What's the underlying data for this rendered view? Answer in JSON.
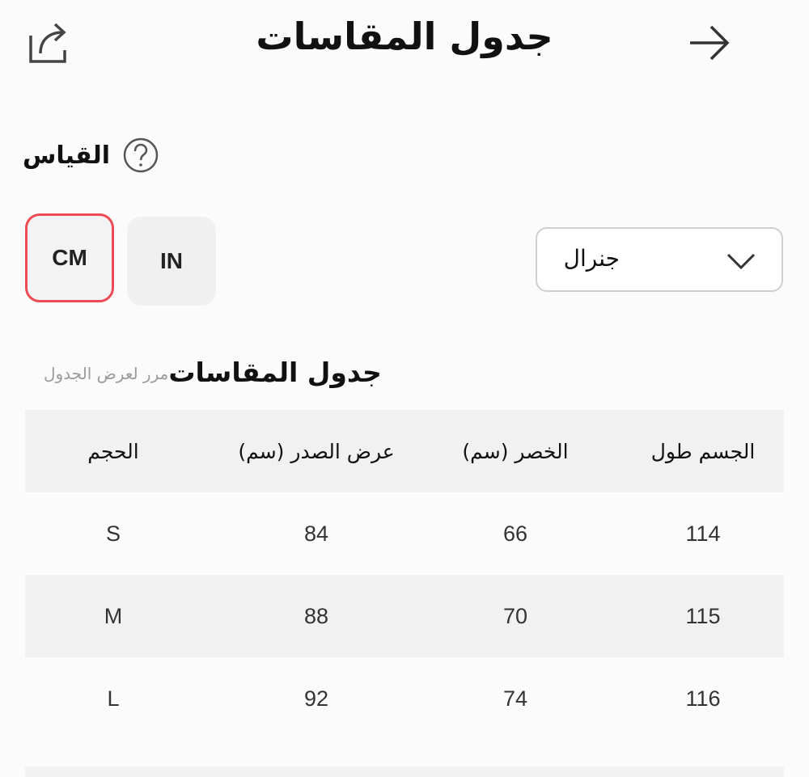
{
  "header": {
    "title": "جدول المقاسات"
  },
  "size_section": {
    "label": "القياس",
    "units": [
      {
        "label": "CM",
        "selected": true
      },
      {
        "label": "IN",
        "selected": false
      }
    ],
    "dropdown": {
      "value": "جنرال"
    }
  },
  "chart_section": {
    "title": "جدول المقاسات",
    "hint": "مرر لعرض الجدول"
  },
  "table": {
    "headers": [
      "الجسم طول",
      "الخصر (سم)",
      "عرض الصدر (سم)",
      "الحجم"
    ],
    "rows": [
      [
        "114",
        "66",
        "84",
        "S"
      ],
      [
        "115",
        "70",
        "88",
        "M"
      ],
      [
        "116",
        "74",
        "92",
        "L"
      ]
    ]
  },
  "colors": {
    "accent": "#ee4a55",
    "row_shade": "#f1f1f1"
  },
  "icons": {
    "back": "arrow-right-icon",
    "share": "share-icon",
    "help": "question-circle-icon",
    "dropdown": "chevron-down-icon"
  }
}
